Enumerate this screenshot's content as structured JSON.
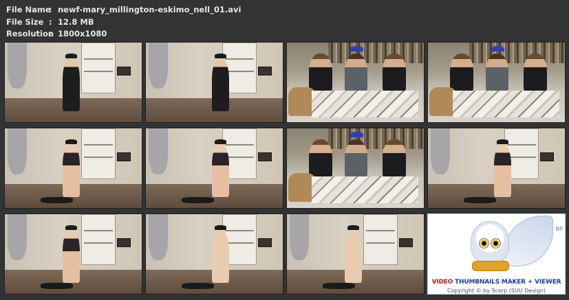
{
  "file_info": {
    "rows": [
      {
        "key": "File Name",
        "sep": ":",
        "value": "newf-mary_millington-eskimo_nell_01.avi"
      },
      {
        "key": "File Size",
        "sep": ":",
        "value": "12.8 MB"
      },
      {
        "key": "Resolution",
        "sep": ":",
        "value": "1800x1080"
      }
    ]
  },
  "thumbnails": [
    {
      "scene": "room",
      "figures": "uniform"
    },
    {
      "scene": "room",
      "figures": "uniform"
    },
    {
      "scene": "table",
      "figures": "three-men"
    },
    {
      "scene": "table",
      "figures": "three-men"
    },
    {
      "scene": "room",
      "figures": "lingerie"
    },
    {
      "scene": "room",
      "figures": "lingerie"
    },
    {
      "scene": "table",
      "figures": "three-men"
    },
    {
      "scene": "room",
      "figures": "lingerie"
    },
    {
      "scene": "room",
      "figures": "lingerie"
    },
    {
      "scene": "room",
      "figures": "bare"
    },
    {
      "scene": "room",
      "figures": "bare"
    }
  ],
  "logo": {
    "brand_part1": "VIDEO ",
    "brand_part2": "THUMBNAILS MAKER + VIEWER",
    "copyright": "Copyright © by Scorp (SUU Design)",
    "corner_text": "BF",
    "icon": "owl-icon"
  },
  "colors": {
    "background": "#333333",
    "header_text": "#e6e6e6",
    "brand_red": "#c0162c",
    "brand_blue": "#1b3f99"
  }
}
